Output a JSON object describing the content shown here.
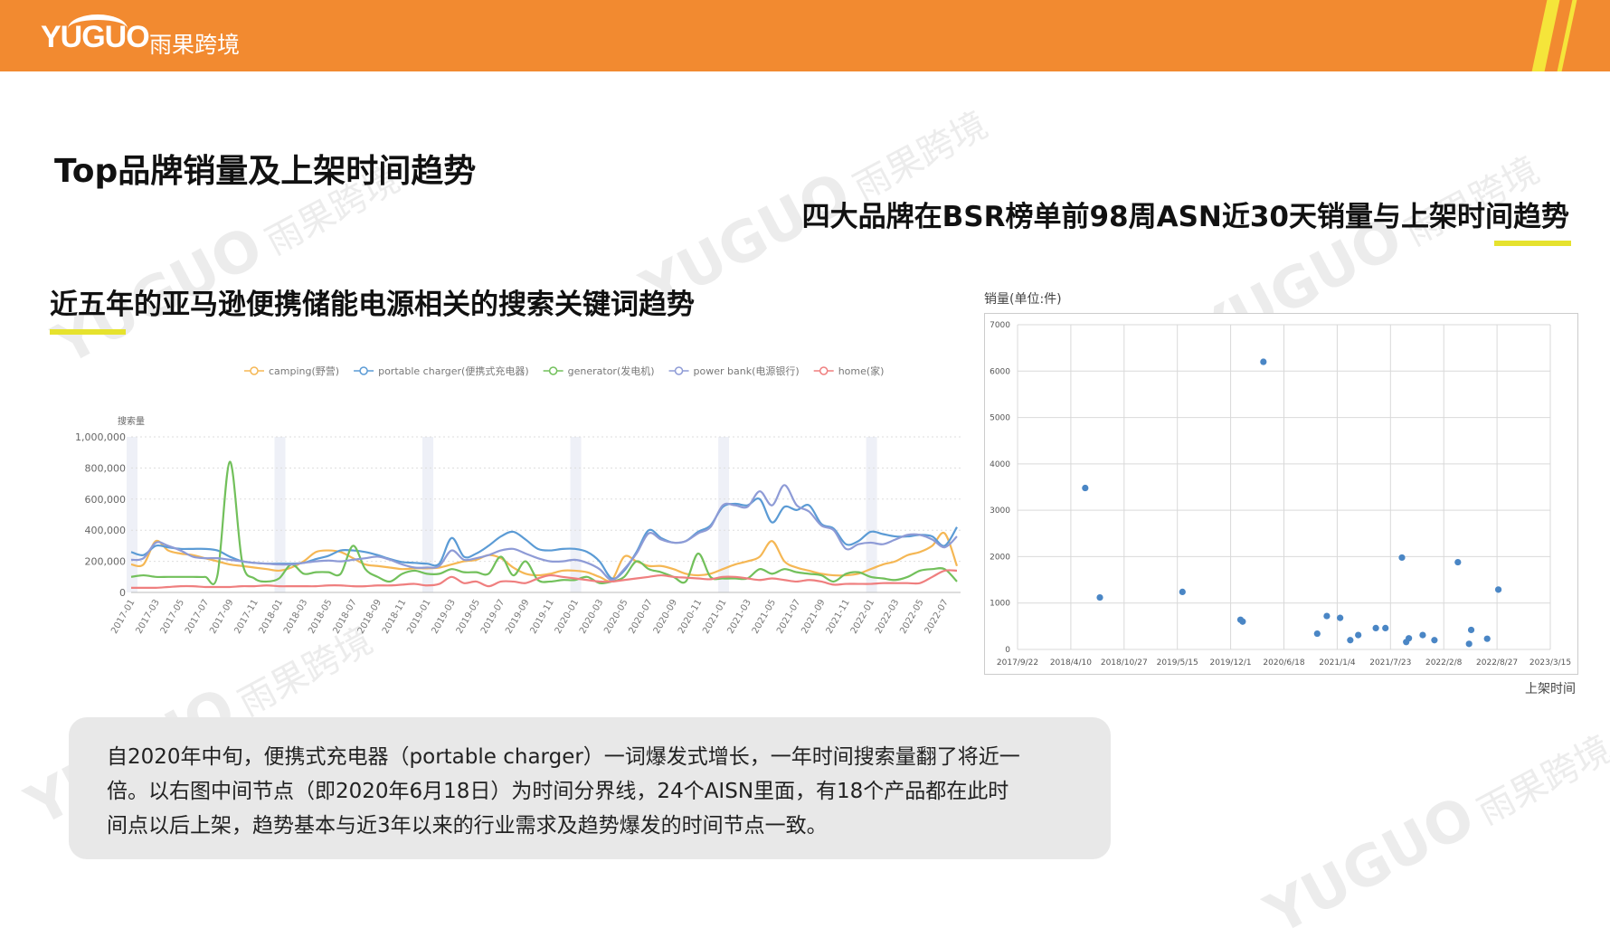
{
  "header": {
    "logo_en": "YUGUO",
    "logo_cn": "雨果跨境",
    "brand_color": "#f28a30",
    "accent_color": "#e6e22e"
  },
  "watermark": {
    "en": "YUGUO",
    "cn": "雨果跨境"
  },
  "titles": {
    "main": "Top品牌销量及上架时间趋势",
    "right": "四大品牌在BSR榜单前98周ASN近30天销量与上架时间趋势",
    "left": "近五年的亚马逊便携储能电源相关的搜索关键词趋势"
  },
  "note": {
    "lines": [
      "自2020年中旬，便携式充电器（portable charger）一词爆发式增长，一年时间搜索量翻了将近一",
      "倍。以右图中间节点（即2020年6月18日）为时间分界线，24个AISN里面，有18个产品都在此时",
      "间点以后上架，趋势基本与近3年以来的行业需求及趋势爆发的时间节点一致。"
    ]
  },
  "chart_data": [
    {
      "type": "line",
      "title": "",
      "ylabel": "搜索量",
      "xlabel": "",
      "ylim": [
        0,
        1000000
      ],
      "yticks": [
        "0",
        "200,000",
        "400,000",
        "600,000",
        "800,000",
        "1,000,000"
      ],
      "legend_position": "top",
      "x_start": "2017-01",
      "xtick_labels": [
        "2017-01",
        "2017-03",
        "2017-05",
        "2017-07",
        "2017-09",
        "2017-11",
        "2018-01",
        "2018-03",
        "2018-05",
        "2018-07",
        "2018-09",
        "2018-11",
        "2019-01",
        "2019-03",
        "2019-05",
        "2019-07",
        "2019-09",
        "2019-11",
        "2020-01",
        "2020-03",
        "2020-05",
        "2020-07",
        "2020-09",
        "2020-11",
        "2021-01",
        "2021-03",
        "2021-05",
        "2021-07",
        "2021-09",
        "2021-11",
        "2022-01",
        "2022-03",
        "2022-05",
        "2022-07"
      ],
      "series": [
        {
          "name": "camping(野营)",
          "color": "#f5b754",
          "values": [
            180000,
            180000,
            330000,
            270000,
            250000,
            240000,
            220000,
            200000,
            180000,
            170000,
            160000,
            150000,
            140000,
            160000,
            200000,
            260000,
            270000,
            260000,
            220000,
            180000,
            170000,
            160000,
            150000,
            155000,
            155000,
            160000,
            180000,
            200000,
            210000,
            240000,
            220000,
            160000,
            120000,
            110000,
            120000,
            140000,
            140000,
            130000,
            100000,
            80000,
            230000,
            200000,
            170000,
            170000,
            150000,
            120000,
            110000,
            120000,
            150000,
            180000,
            200000,
            230000,
            330000,
            200000,
            160000,
            140000,
            120000,
            110000,
            110000,
            120000,
            150000,
            180000,
            200000,
            240000,
            260000,
            300000,
            380000,
            170000
          ]
        },
        {
          "name": "portable charger(便携式充电器)",
          "color": "#5b9bd5",
          "values": [
            260000,
            240000,
            300000,
            290000,
            280000,
            280000,
            280000,
            270000,
            230000,
            200000,
            190000,
            185000,
            185000,
            185000,
            190000,
            215000,
            235000,
            270000,
            270000,
            260000,
            240000,
            215000,
            195000,
            190000,
            185000,
            185000,
            350000,
            230000,
            250000,
            300000,
            360000,
            390000,
            340000,
            280000,
            270000,
            280000,
            280000,
            260000,
            200000,
            90000,
            140000,
            260000,
            400000,
            350000,
            320000,
            330000,
            390000,
            430000,
            550000,
            570000,
            560000,
            600000,
            450000,
            550000,
            530000,
            560000,
            440000,
            410000,
            310000,
            330000,
            390000,
            375000,
            360000,
            360000,
            370000,
            360000,
            300000,
            420000
          ]
        },
        {
          "name": "generator(发电机)",
          "color": "#72c05b",
          "values": [
            100000,
            110000,
            100000,
            100000,
            100000,
            100000,
            100000,
            110000,
            840000,
            200000,
            90000,
            70000,
            90000,
            180000,
            120000,
            130000,
            130000,
            120000,
            300000,
            150000,
            100000,
            70000,
            120000,
            140000,
            120000,
            120000,
            150000,
            130000,
            130000,
            120000,
            230000,
            110000,
            200000,
            80000,
            70000,
            80000,
            80000,
            100000,
            60000,
            70000,
            100000,
            200000,
            150000,
            130000,
            100000,
            70000,
            250000,
            100000,
            90000,
            90000,
            90000,
            150000,
            120000,
            150000,
            130000,
            120000,
            110000,
            70000,
            120000,
            130000,
            100000,
            90000,
            80000,
            100000,
            140000,
            150000,
            150000,
            70000
          ]
        },
        {
          "name": "power bank(电源银行)",
          "color": "#8e9bd6",
          "values": [
            210000,
            220000,
            320000,
            300000,
            270000,
            230000,
            220000,
            220000,
            210000,
            200000,
            190000,
            185000,
            180000,
            180000,
            190000,
            200000,
            205000,
            200000,
            210000,
            220000,
            230000,
            210000,
            180000,
            160000,
            160000,
            170000,
            270000,
            210000,
            220000,
            240000,
            270000,
            280000,
            250000,
            220000,
            200000,
            200000,
            210000,
            190000,
            150000,
            80000,
            150000,
            250000,
            380000,
            340000,
            320000,
            330000,
            380000,
            420000,
            560000,
            560000,
            550000,
            650000,
            560000,
            690000,
            560000,
            520000,
            430000,
            400000,
            280000,
            310000,
            320000,
            310000,
            340000,
            370000,
            370000,
            340000,
            290000,
            360000
          ]
        },
        {
          "name": "home(家)",
          "color": "#ef7f7f",
          "values": [
            30000,
            30000,
            30000,
            35000,
            40000,
            40000,
            35000,
            35000,
            35000,
            40000,
            40000,
            45000,
            40000,
            40000,
            40000,
            40000,
            45000,
            45000,
            40000,
            40000,
            45000,
            45000,
            50000,
            55000,
            45000,
            55000,
            100000,
            60000,
            70000,
            40000,
            70000,
            70000,
            60000,
            90000,
            110000,
            100000,
            90000,
            80000,
            70000,
            70000,
            80000,
            90000,
            100000,
            110000,
            100000,
            95000,
            90000,
            85000,
            100000,
            100000,
            90000,
            80000,
            90000,
            80000,
            70000,
            80000,
            70000,
            50000,
            55000,
            55000,
            55000,
            60000,
            60000,
            60000,
            60000,
            100000,
            140000,
            140000
          ]
        }
      ]
    },
    {
      "type": "scatter",
      "title": "",
      "ylabel": "销量(单位:件)",
      "xlabel": "上架时间",
      "ylim": [
        0,
        7000
      ],
      "yticks": [
        "0",
        "1000",
        "2000",
        "3000",
        "4000",
        "5000",
        "6000",
        "7000"
      ],
      "xlim": [
        "2017-09-22",
        "2023-03-15"
      ],
      "xtick_labels": [
        "2017/9/22",
        "2018/4/10",
        "2018/10/27",
        "2019/5/15",
        "2019/12/1",
        "2020/6/18",
        "2021/1/4",
        "2021/7/23",
        "2022/2/8",
        "2022/8/27",
        "2023/3/15"
      ],
      "color": "#4a86c5",
      "points": [
        {
          "x": "2018-06-03",
          "y": 3480
        },
        {
          "x": "2018-07-28",
          "y": 1120
        },
        {
          "x": "2019-06-03",
          "y": 1240
        },
        {
          "x": "2020-01-07",
          "y": 640
        },
        {
          "x": "2020-01-15",
          "y": 600
        },
        {
          "x": "2020-04-02",
          "y": 6200
        },
        {
          "x": "2020-10-21",
          "y": 340
        },
        {
          "x": "2020-11-26",
          "y": 720
        },
        {
          "x": "2021-01-15",
          "y": 680
        },
        {
          "x": "2021-02-22",
          "y": 200
        },
        {
          "x": "2021-03-24",
          "y": 310
        },
        {
          "x": "2021-05-29",
          "y": 460
        },
        {
          "x": "2021-07-04",
          "y": 460
        },
        {
          "x": "2021-09-04",
          "y": 1980
        },
        {
          "x": "2021-09-20",
          "y": 160
        },
        {
          "x": "2021-09-30",
          "y": 240
        },
        {
          "x": "2021-11-21",
          "y": 310
        },
        {
          "x": "2022-01-04",
          "y": 200
        },
        {
          "x": "2022-04-02",
          "y": 1880
        },
        {
          "x": "2022-05-14",
          "y": 120
        },
        {
          "x": "2022-05-22",
          "y": 420
        },
        {
          "x": "2022-07-21",
          "y": 230
        },
        {
          "x": "2022-09-01",
          "y": 1290
        }
      ]
    }
  ]
}
